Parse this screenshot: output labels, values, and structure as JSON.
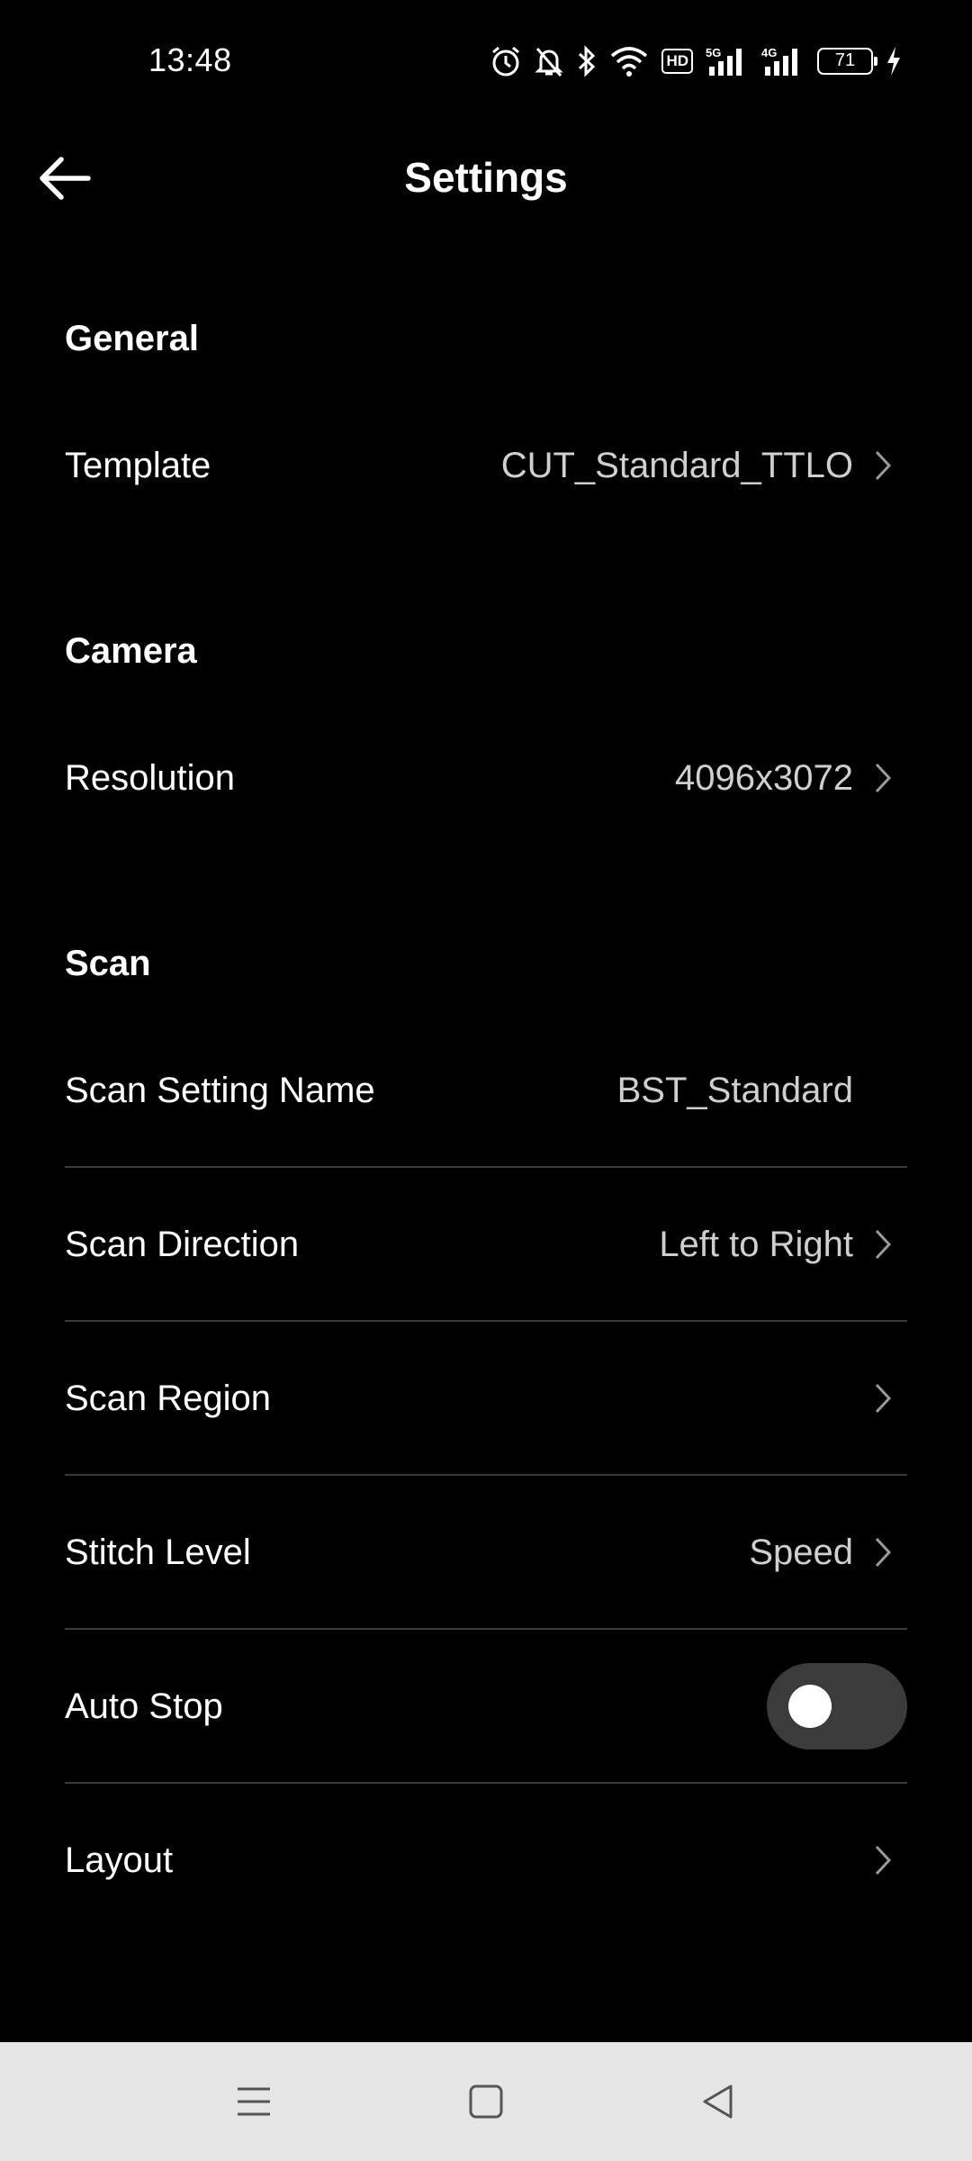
{
  "status_bar": {
    "time": "13:48",
    "battery_level": "71",
    "hd_badge": "HD",
    "icons": [
      "alarm-icon",
      "mute-icon",
      "bluetooth-icon",
      "wifi-icon",
      "hd-icon",
      "signal-5g-icon",
      "signal-4g-icon",
      "battery-icon",
      "charging-icon"
    ]
  },
  "header": {
    "title": "Settings",
    "back_icon": "back-arrow-icon"
  },
  "sections": {
    "general": {
      "title": "General",
      "template": {
        "label": "Template",
        "value": "CUT_Standard_TTLO"
      }
    },
    "camera": {
      "title": "Camera",
      "resolution": {
        "label": "Resolution",
        "value": "4096x3072"
      }
    },
    "scan": {
      "title": "Scan",
      "setting_name": {
        "label": "Scan Setting Name",
        "value": "BST_Standard"
      },
      "direction": {
        "label": "Scan Direction",
        "value": "Left to Right"
      },
      "region": {
        "label": "Scan Region",
        "value": ""
      },
      "stitch_level": {
        "label": "Stitch Level",
        "value": "Speed"
      },
      "auto_stop": {
        "label": "Auto Stop",
        "enabled": false
      },
      "layout": {
        "label": "Layout",
        "value": ""
      }
    }
  },
  "nav_bar": {
    "buttons": [
      "menu-icon",
      "home-icon",
      "back-triangle-icon"
    ]
  },
  "colors": {
    "background": "#000000",
    "text_primary": "#ffffff",
    "text_secondary": "#cfcfcf",
    "divider": "#3a3a3a",
    "toggle_track": "#3b3b3b",
    "navbar_bg": "#e6e6e6"
  }
}
